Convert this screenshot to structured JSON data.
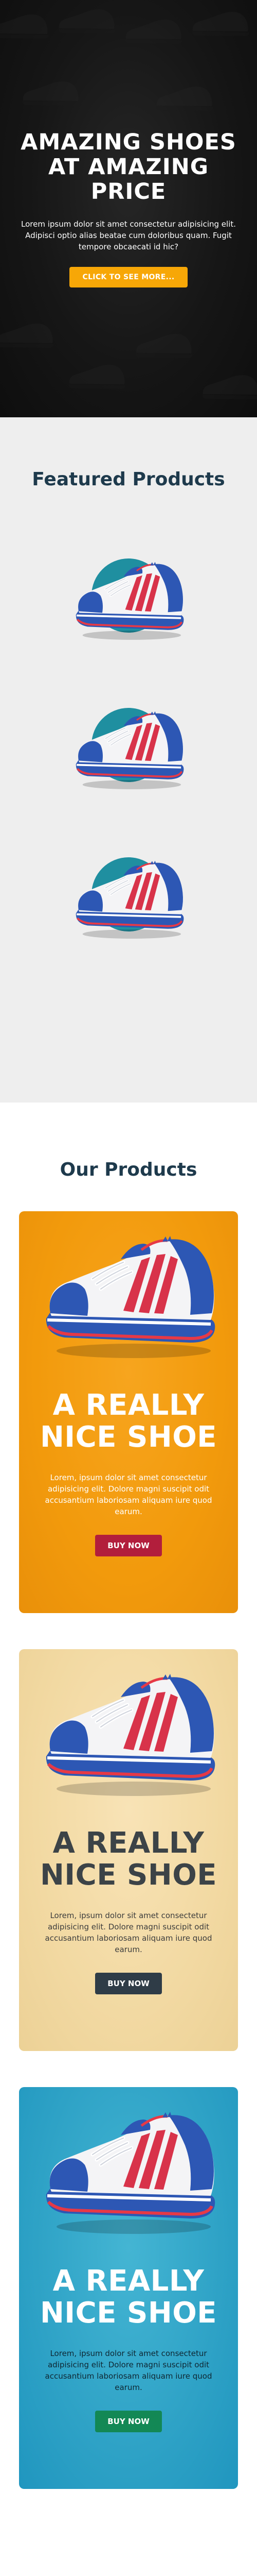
{
  "hero": {
    "title": "AMAZING SHOES AT AMAZING PRICE",
    "text": "Lorem ipsum dolor sit amet consectetur adipisicing elit. Adipisci optio alias beatae cum doloribus quam. Fugit tempore obcaecati id hic?",
    "button_label": "CLICK TO SEE MORE..."
  },
  "featured": {
    "title": "Featured Products",
    "items": [
      {
        "name": "sneaker-1"
      },
      {
        "name": "sneaker-2"
      },
      {
        "name": "sneaker-3"
      }
    ],
    "accent_color": "#1f8fa0"
  },
  "products": {
    "title": "Our Products",
    "cards": [
      {
        "title": "A REALLY NICE SHOE",
        "text": "Lorem, ipsum dolor sit amet consectetur adipisicing elit. Dolore magni suscipit odit accusantium laboriosam aliquam iure quod earum.",
        "button_label": "BUY NOW",
        "background": "#f29a0c",
        "button_color": "#b21e3c"
      },
      {
        "title": "A REALLY NICE SHOE",
        "text": "Lorem, ipsum dolor sit amet consectetur adipisicing elit. Dolore magni suscipit odit accusantium laboriosam aliquam iure quod earum.",
        "button_label": "BUY NOW",
        "background": "#f2d9a2",
        "button_color": "#2f3c47"
      },
      {
        "title": "A REALLY NICE SHOE",
        "text": "Lorem, ipsum dolor sit amet consectetur adipisicing elit. Dolore magni suscipit odit accusantium laboriosam aliquam iure quod earum.",
        "button_label": "BUY NOW",
        "background": "#2ea2c6",
        "button_color": "#138855"
      }
    ]
  }
}
